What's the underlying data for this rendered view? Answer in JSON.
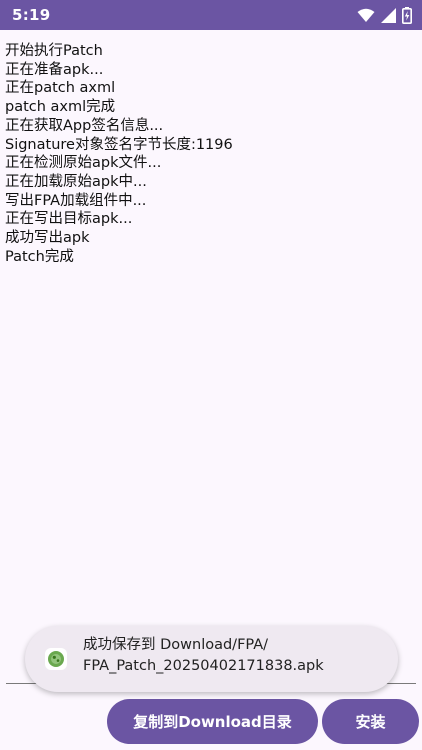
{
  "status_bar": {
    "time": "5:19",
    "icons": [
      "wifi-icon",
      "signal-icon",
      "battery-charging-icon"
    ]
  },
  "log": {
    "lines": [
      "开始执行Patch",
      "正在准备apk...",
      "正在patch axml",
      "patch axml完成",
      "正在获取App签名信息...",
      "Signature对象签名字节长度:1196",
      "正在检测原始apk文件...",
      "正在加载原始apk中...",
      "写出FPA加载组件中...",
      "正在写出目标apk...",
      "成功写出apk",
      "Patch完成"
    ]
  },
  "toast": {
    "icon": "app-icon",
    "line1": "成功保存到 Download/FPA/",
    "line2": "FPA_Patch_20250402171838.apk"
  },
  "buttons": {
    "copy_label": "复制到Download目录",
    "install_label": "安装"
  },
  "colors": {
    "accent": "#6b55a3",
    "background": "#fcf7fe",
    "toast_background": "#efe9f1"
  }
}
